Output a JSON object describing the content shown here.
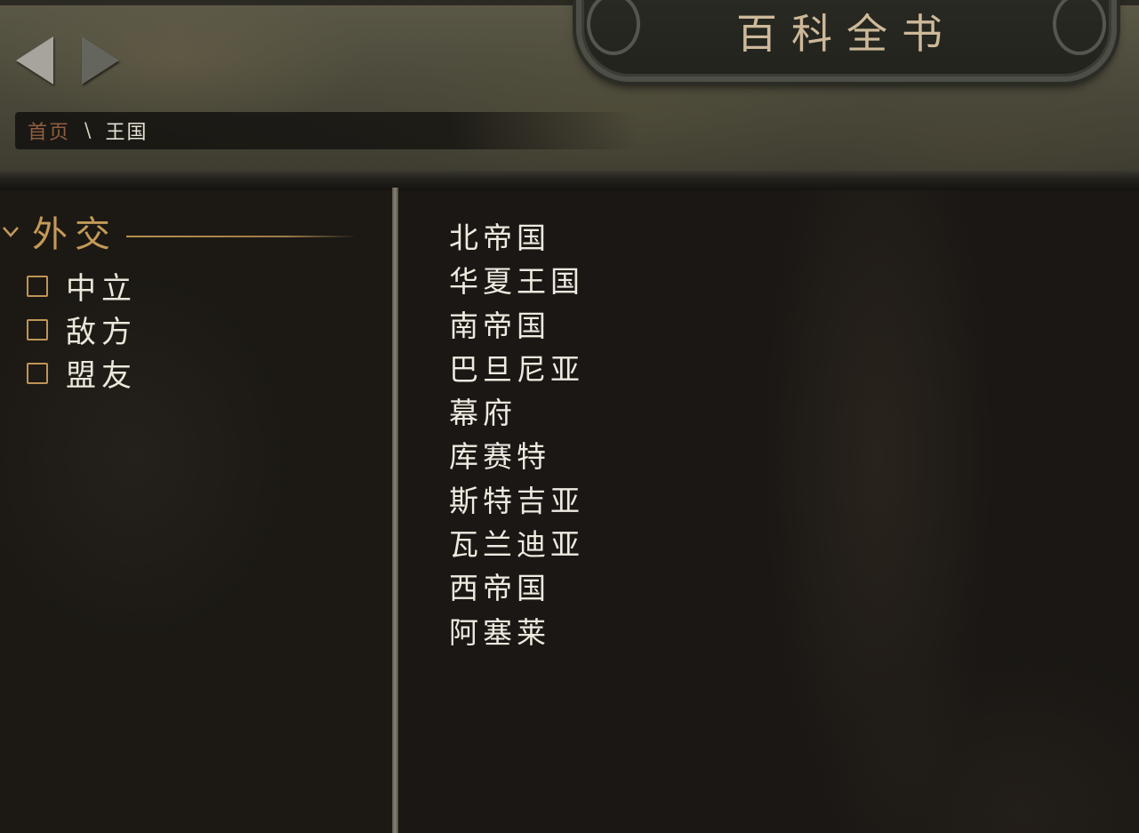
{
  "header": {
    "title": "百科全书",
    "nav": {
      "back_icon": "arrow-left-icon",
      "forward_icon": "arrow-right-icon"
    },
    "breadcrumb": {
      "home": "首页",
      "separator": "\\",
      "current": "王国"
    }
  },
  "sidebar": {
    "section_icon": "chevron-down-icon",
    "section_title": "外交",
    "filters": [
      {
        "label": "中立",
        "checked": false
      },
      {
        "label": "敌方",
        "checked": false
      },
      {
        "label": "盟友",
        "checked": false
      }
    ]
  },
  "main": {
    "kingdoms": [
      "北帝国",
      "华夏王国",
      "南帝国",
      "巴旦尼亚",
      "幕府",
      "库赛特",
      "斯特吉亚",
      "瓦兰迪亚",
      "西帝国",
      "阿塞莱"
    ]
  },
  "colors": {
    "accent_gold": "#c49a57",
    "breadcrumb_home": "#8f5e41",
    "text_light": "#eeeae0"
  }
}
